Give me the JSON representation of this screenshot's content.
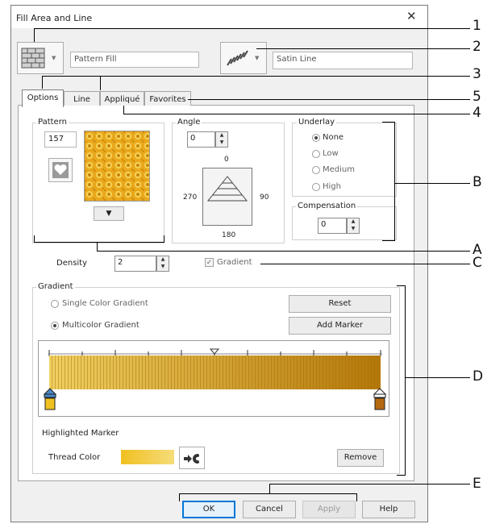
{
  "window": {
    "title": "Fill Area and Line",
    "close_symbol": "✕"
  },
  "fill": {
    "value": "Pattern Fill",
    "icon": "pattern-fill-icon"
  },
  "line": {
    "value": "Satin Line",
    "icon": "satin-line-icon"
  },
  "tabs": [
    {
      "label": "Options",
      "active": true
    },
    {
      "label": "Line"
    },
    {
      "label": "Appliqué"
    },
    {
      "label": "Favorites"
    }
  ],
  "pattern": {
    "label": "Pattern",
    "number": "157",
    "dropdown_symbol": "▼"
  },
  "angle": {
    "label": "Angle",
    "value": "0",
    "dial_top": "0",
    "dial_left": "270",
    "dial_right": "90",
    "dial_bottom": "180"
  },
  "underlay": {
    "label": "Underlay",
    "options": [
      {
        "label": "None",
        "selected": true
      },
      {
        "label": "Low"
      },
      {
        "label": "Medium"
      },
      {
        "label": "High"
      }
    ]
  },
  "compensation": {
    "label": "Compensation",
    "value": "0"
  },
  "density": {
    "label": "Density",
    "value": "2"
  },
  "gradient_checkbox": {
    "label": "Gradient",
    "checked": true,
    "check_symbol": "✓"
  },
  "gradient": {
    "label": "Gradient",
    "single": "Single Color Gradient",
    "multi": "Multicolor Gradient",
    "selected": "multi",
    "reset": "Reset",
    "add_marker": "Add Marker",
    "colors": {
      "light": "#f0d060",
      "dark": "#b57808",
      "stripe": "#a06a10"
    }
  },
  "highlighted_marker": {
    "label": "Highlighted Marker",
    "thread_color_label": "Thread Color",
    "remove": "Remove"
  },
  "buttons": {
    "ok": "OK",
    "cancel": "Cancel",
    "apply": "Apply",
    "help": "Help"
  },
  "callouts": {
    "n1": "1",
    "n2": "2",
    "n3": "3",
    "n5": "5",
    "n4": "4",
    "B": "B",
    "A": "A",
    "C": "C",
    "D": "D",
    "E": "E"
  }
}
